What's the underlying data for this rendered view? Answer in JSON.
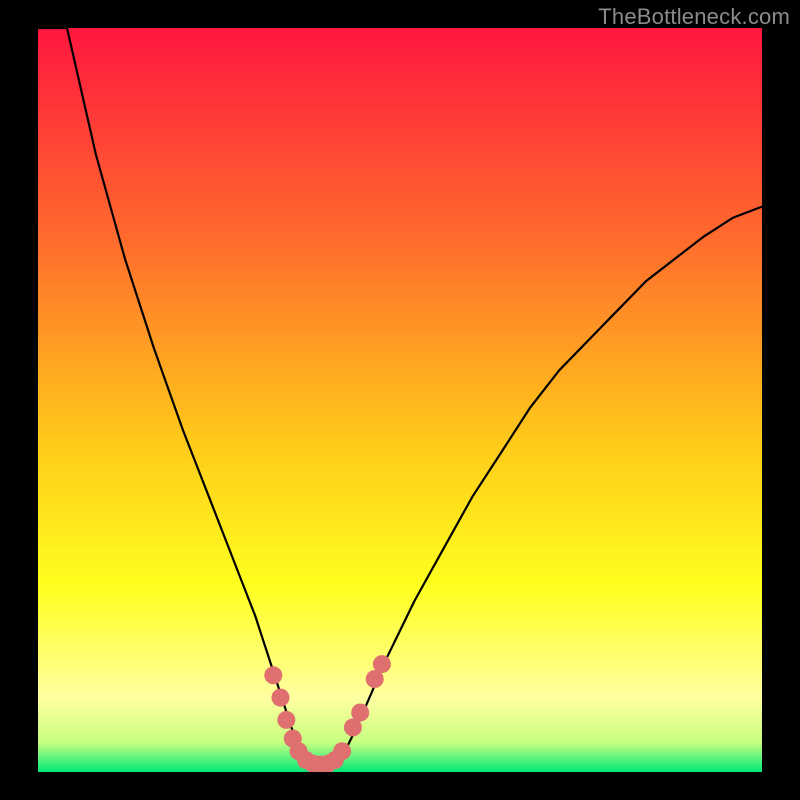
{
  "attribution": "TheBottleneck.com",
  "colors": {
    "gradient_top": "#ff173f",
    "gradient_mid1": "#ff6a2d",
    "gradient_mid2": "#ffc81a",
    "gradient_mid3": "#ffff1e",
    "gradient_pale": "#ffffa0",
    "gradient_green": "#00e878",
    "curve": "#000000",
    "marker": "#e07070",
    "background": "#000000"
  },
  "chart_data": {
    "type": "line",
    "title": "",
    "xlabel": "",
    "ylabel": "",
    "xlim": [
      0,
      100
    ],
    "ylim": [
      0,
      100
    ],
    "series": [
      {
        "name": "bottleneck-curve",
        "x": [
          0,
          4,
          8,
          12,
          16,
          20,
          24,
          28,
          30,
          32,
          34,
          35,
          36,
          37,
          38,
          39,
          40,
          41,
          42,
          44,
          48,
          52,
          56,
          60,
          64,
          68,
          72,
          76,
          80,
          84,
          88,
          92,
          96,
          100
        ],
        "y": [
          120,
          100,
          83,
          69,
          57,
          46,
          36,
          26,
          21,
          15,
          9,
          6,
          3.5,
          2,
          1.2,
          1,
          1,
          1.2,
          2,
          6,
          15,
          23,
          30,
          37,
          43,
          49,
          54,
          58,
          62,
          66,
          69,
          72,
          74.5,
          76
        ]
      }
    ],
    "markers": {
      "name": "highlight-points",
      "points": [
        {
          "x": 32.5,
          "y": 13
        },
        {
          "x": 33.5,
          "y": 10
        },
        {
          "x": 34.3,
          "y": 7
        },
        {
          "x": 35.2,
          "y": 4.5
        },
        {
          "x": 36,
          "y": 2.8
        },
        {
          "x": 37,
          "y": 1.6
        },
        {
          "x": 38,
          "y": 1.1
        },
        {
          "x": 39,
          "y": 1
        },
        {
          "x": 40,
          "y": 1.1
        },
        {
          "x": 41,
          "y": 1.6
        },
        {
          "x": 42,
          "y": 2.8
        },
        {
          "x": 43.5,
          "y": 6
        },
        {
          "x": 44.5,
          "y": 8
        },
        {
          "x": 46.5,
          "y": 12.5
        },
        {
          "x": 47.5,
          "y": 14.5
        }
      ]
    }
  }
}
